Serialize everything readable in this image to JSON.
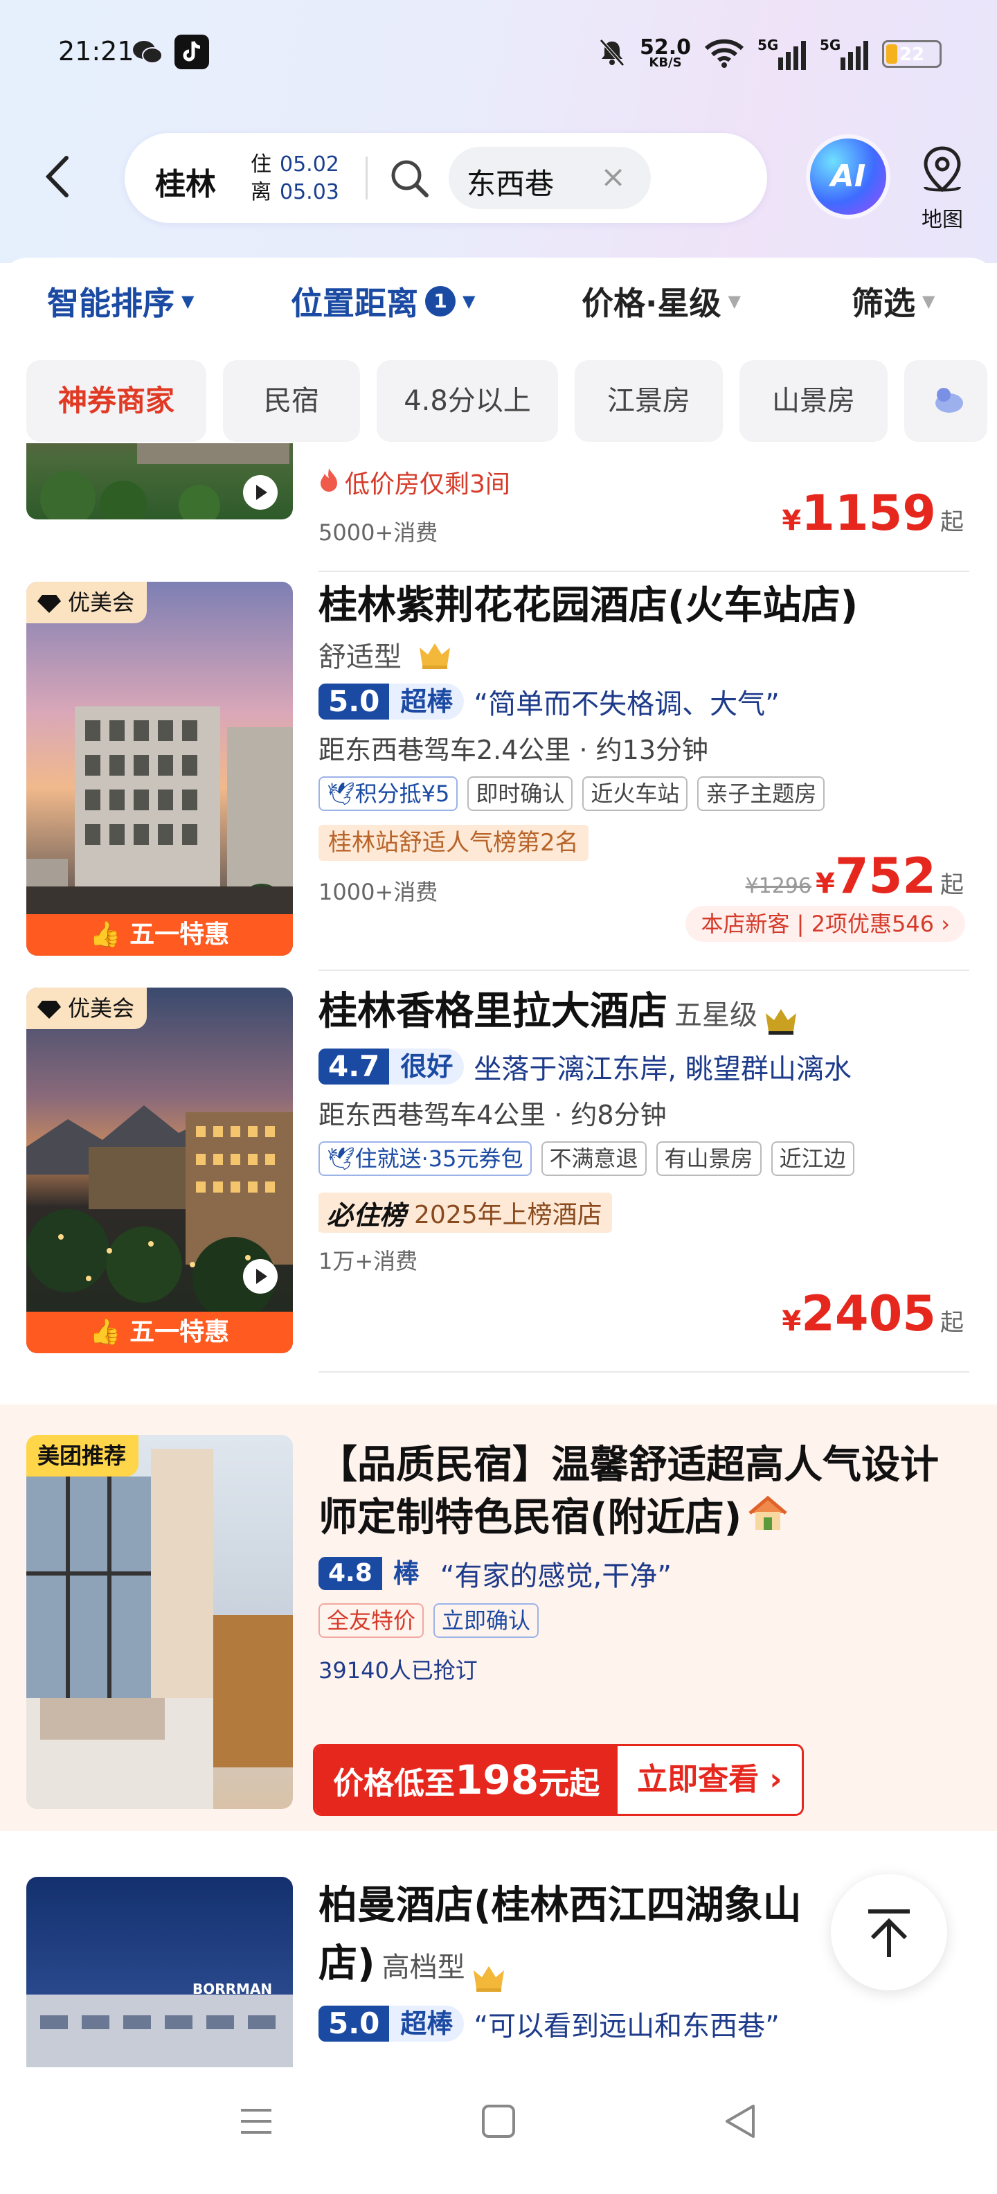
{
  "status": {
    "time": "21:21",
    "speed": "52.0",
    "speed_unit": "KB/S",
    "net1": "5G",
    "net2": "5G",
    "battery": "22",
    "battery_level": 0.22
  },
  "search": {
    "city": "桂林",
    "checkin_label": "住",
    "checkin": "05.02",
    "checkout_label": "离",
    "checkout": "05.03",
    "keyword": "东西巷",
    "clear": "×"
  },
  "header": {
    "ai_label": "AI",
    "map_label": "地图"
  },
  "sort_tabs": [
    {
      "label": "智能排序",
      "badge": ""
    },
    {
      "label": "位置距离",
      "badge": "1"
    },
    {
      "label": "价格·星级",
      "badge": ""
    },
    {
      "label": "筛选",
      "badge": ""
    }
  ],
  "quick_filters": [
    "神券商家",
    "民宿",
    "4.8分以上",
    "江景房",
    "山景房"
  ],
  "hotel0": {
    "tip": "低价房仅剩3间",
    "sold": "5000+消费",
    "yen": "¥",
    "price": "1159",
    "suffix": "起"
  },
  "hotel1": {
    "badge": "优美会",
    "name": "桂林紫荆花花园酒店(火车站店)",
    "level": "舒适型",
    "score": "5.0",
    "score_tag": "超棒",
    "quote": "“简单而不失格调、大气”",
    "distance": "距东西巷驾车2.4公里 · 约13分钟",
    "tags": [
      "积分抵¥5",
      "即时确认",
      "近火车站",
      "亲子主题房"
    ],
    "rank": "桂林站舒适人气榜第2名",
    "orig_price": "¥1296",
    "yen": "¥",
    "price": "752",
    "suffix": "起",
    "sold": "1000+消费",
    "new_customer": "本店新客 | 2项优惠546 ›",
    "promo": "五一特惠"
  },
  "hotel2": {
    "badge": "优美会",
    "name": "桂林香格里拉大酒店",
    "level": "五星级",
    "score": "4.7",
    "score_tag": "很好",
    "quote": "坐落于漓江东岸, 眺望群山漓水",
    "distance": "距东西巷驾车4公里 · 约8分钟",
    "tags": [
      "住就送·35元券包",
      "不满意退",
      "有山景房",
      "近江边"
    ],
    "rank_brand": "必住榜",
    "rank": "2025年上榜酒店",
    "sold": "1万+消费",
    "yen": "¥",
    "price": "2405",
    "suffix": "起",
    "promo": "五一特惠"
  },
  "hotel3": {
    "badge": "美团推荐",
    "name": "【品质民宿】温馨舒适超高人气设计师定制特色民宿(附近店)",
    "score": "4.8",
    "score_tag": "棒",
    "quote": "“有家的感觉,干净”",
    "tags": [
      "全友特价",
      "立即确认"
    ],
    "booked": "39140人已抢订",
    "btn_prefix": "价格低至",
    "btn_price": "198",
    "btn_suffix": "元起",
    "btn_action": "立即查看 ›"
  },
  "hotel4": {
    "name": "柏曼酒店(桂林西江四湖象山店)",
    "level": "高档型",
    "score": "5.0",
    "score_tag": "超棒",
    "quote": "“可以看到远山和东西巷”",
    "sign": "BORRMAN"
  },
  "colors": {
    "primary_blue": "#1b4aa3",
    "price_red": "#e6271e",
    "promo_orange": "#ff5a1f"
  }
}
